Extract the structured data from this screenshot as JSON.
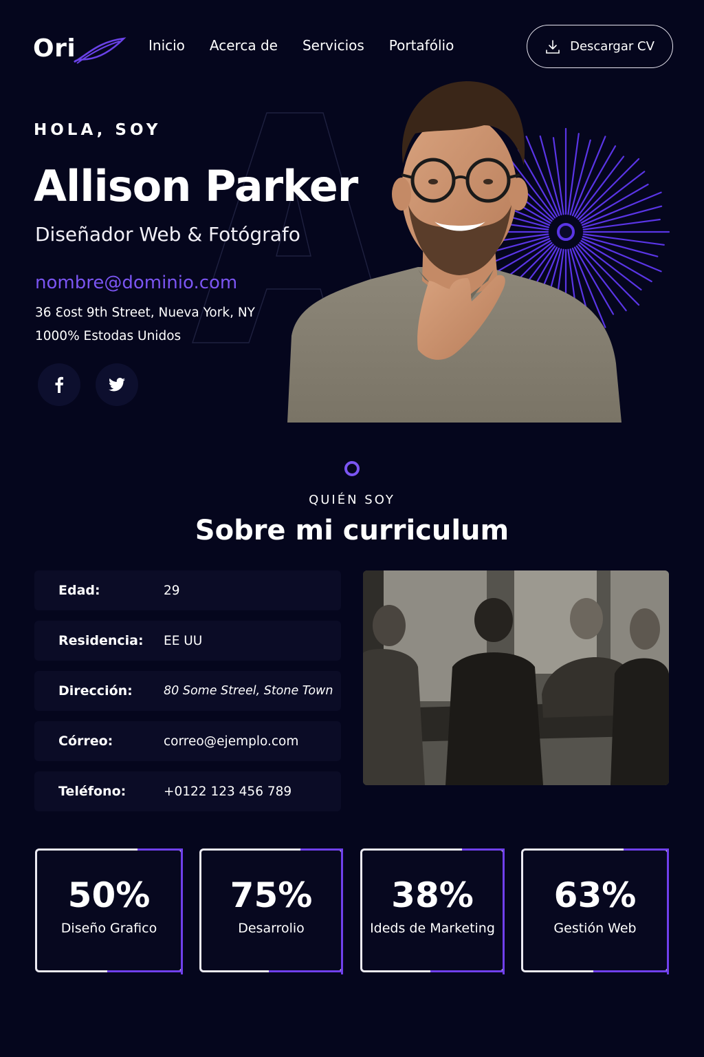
{
  "header": {
    "logo": "Ori",
    "nav": [
      "Inicio",
      "Acerca de",
      "Servicios",
      "Portafólio"
    ],
    "cv_button": "Descargar CV"
  },
  "hero": {
    "kicker": "HOLA, SOY",
    "name": "Allison Parker",
    "role": "Diseñador Web & Fotógrafo",
    "email": "nombre@dominio.com",
    "address_line1": "36 Ɛost 9th Street, Nueva York, NY",
    "address_line2": "1000% Estodas Unidos",
    "social": [
      "facebook-icon",
      "twitter-icon"
    ],
    "accent_color": "#7b55f2"
  },
  "about": {
    "kicker": "QUIÉN SOY",
    "title": "Sobre mi curriculum",
    "rows": [
      {
        "label": "Edad:",
        "value": "29"
      },
      {
        "label": "Residencia:",
        "value": "EE UU"
      },
      {
        "label": "Dirección:",
        "value": "80 Some Streel, Stone Town"
      },
      {
        "label": "Córreo:",
        "value": "correo@ejemplo.com"
      },
      {
        "label": "Teléfono:",
        "value": "+0122 123 456 789"
      }
    ]
  },
  "stats": [
    {
      "percent": "50%",
      "label": "Diseño Grafico",
      "value": 50
    },
    {
      "percent": "75%",
      "label": "Desarrolio",
      "value": 75
    },
    {
      "percent": "38%",
      "label": "Ideds de Marketing",
      "value": 38
    },
    {
      "percent": "63%",
      "label": "Gestión Web",
      "value": 63
    }
  ]
}
